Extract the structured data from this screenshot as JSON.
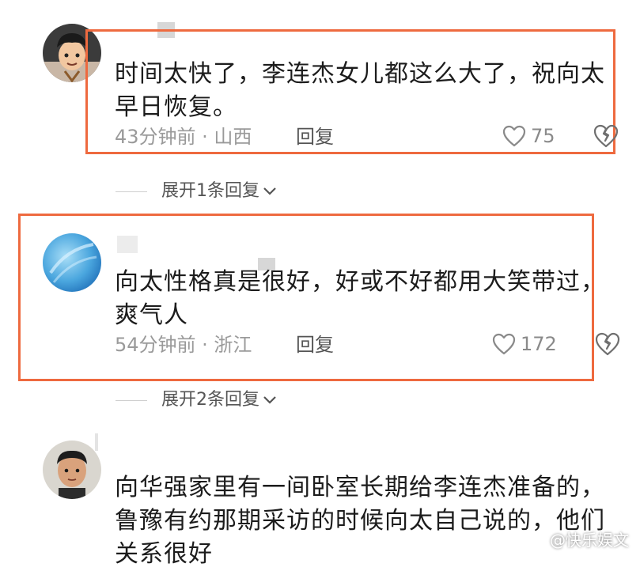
{
  "comments": [
    {
      "text_lines": [
        "时间太快了，李连杰女儿都这么大了，祝向太",
        "早日恢复。"
      ],
      "time_location": "43分钟前 · 山西",
      "reply_label": "回复",
      "like_count": "75",
      "expand_label": "展开1条回复",
      "highlighted": true
    },
    {
      "text_lines": [
        "向太性格真是很好，好或不好都用大笑带过，",
        "爽气人"
      ],
      "time_location": "54分钟前 · 浙江",
      "reply_label": "回复",
      "like_count": "172",
      "expand_label": "展开2条回复",
      "highlighted": true
    },
    {
      "text_lines": [
        "向华强家里有一间卧室长期给李连杰准备的，",
        "鲁豫有约那期采访的时候向太自己说的，他们",
        "关系很好"
      ],
      "highlighted": false
    }
  ],
  "watermark": "@快乐娱文",
  "colors": {
    "highlight_border": "#ee6a3f",
    "meta_text": "#9a9a9a",
    "body_text": "#1c1c1c"
  },
  "icons": {
    "like": "heart-outline-icon",
    "dislike": "broken-heart-icon",
    "expand": "chevron-down-icon"
  }
}
